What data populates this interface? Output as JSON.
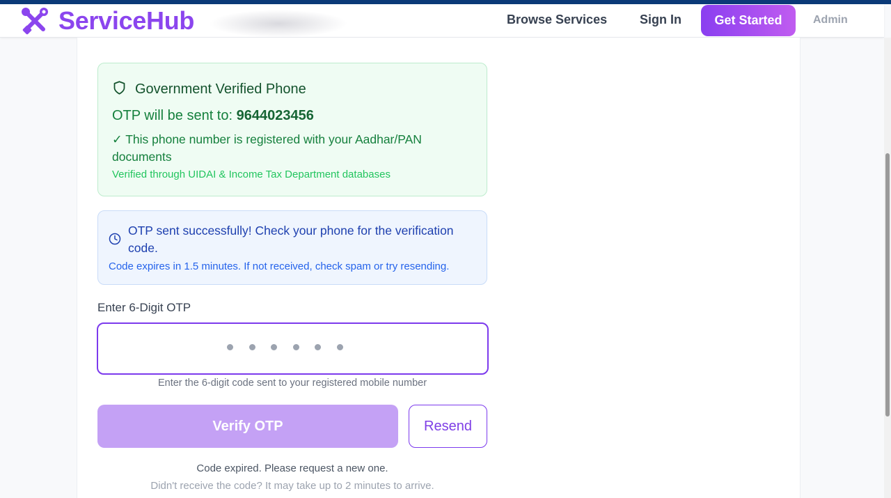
{
  "nav": {
    "brand": "ServiceHub",
    "links": {
      "browse": "Browse Services",
      "signin": "Sign In",
      "get_started": "Get Started",
      "admin": "Admin"
    }
  },
  "verified_card": {
    "title": "Government Verified Phone",
    "sent_to_label": "OTP will be sent to: ",
    "phone_number": "9644023456",
    "registered_text": "✓ This phone number is registered with your Aadhar/PAN documents",
    "verified_through": "Verified through UIDAI & Income Tax Department databases",
    "icon": "shield-icon"
  },
  "info_card": {
    "message": "OTP sent successfully! Check your phone for the verification code.",
    "sub_message": "Code expires in 1.5 minutes. If not received, check spam or try resending.",
    "icon": "clock-icon"
  },
  "otp_form": {
    "label": "Enter 6-Digit OTP",
    "value": "",
    "placeholder_dots": 6,
    "hint": "Enter the 6-digit code sent to your registered mobile number",
    "verify_label": "Verify OTP",
    "resend_label": "Resend",
    "expired_text": "Code expired. Please request a new one.",
    "didnt_receive_text": "Didn't receive the code? It may take up to 2 minutes to arrive."
  },
  "colors": {
    "brand": "#8b45ee",
    "primary_button": "#c4a1f5",
    "success_bg": "#effcf3",
    "info_bg": "#eff5fe"
  }
}
